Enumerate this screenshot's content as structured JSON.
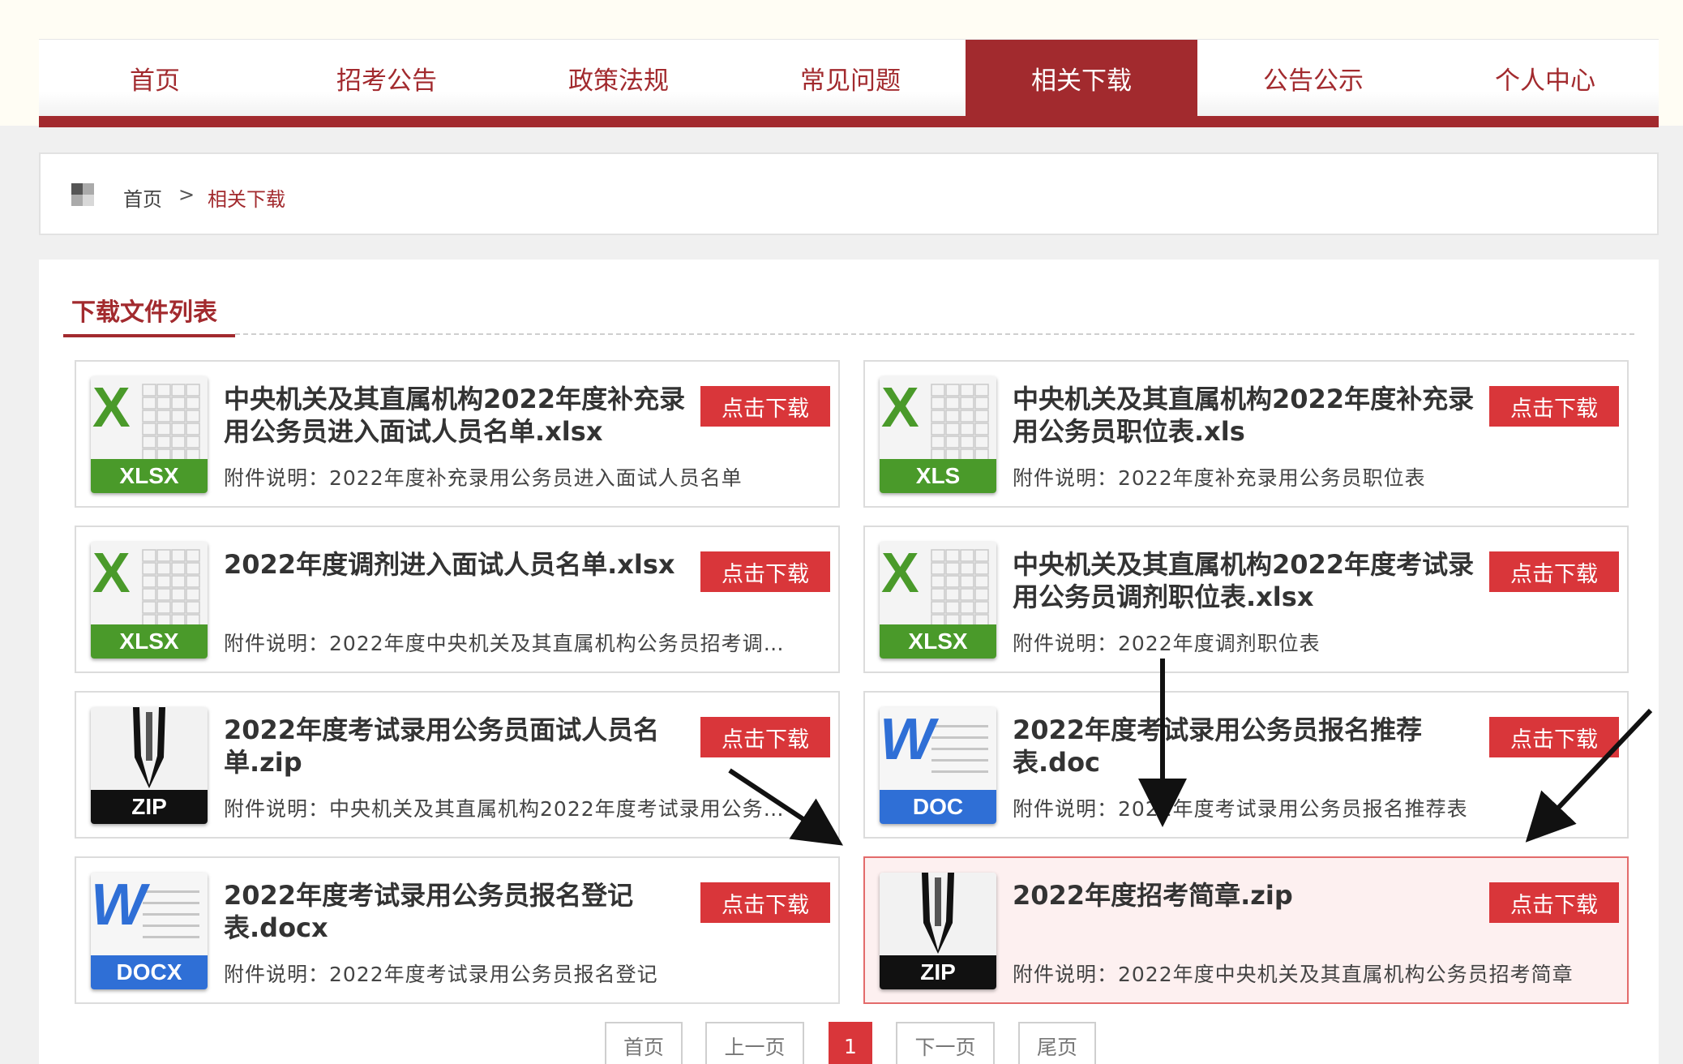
{
  "nav": {
    "items": [
      {
        "label": "首页"
      },
      {
        "label": "招考公告"
      },
      {
        "label": "政策法规"
      },
      {
        "label": "常见问题"
      },
      {
        "label": "相关下载",
        "active": true
      },
      {
        "label": "公告公示"
      },
      {
        "label": "个人中心"
      }
    ]
  },
  "breadcrumb": {
    "home": "首页",
    "separator": ">",
    "current": "相关下载"
  },
  "panel": {
    "title": "下载文件列表"
  },
  "files": [
    {
      "type": "XLSX",
      "title": "中央机关及其直属机构2022年度补充录用公务员进入面试人员名单.xlsx",
      "desc": "附件说明：2022年度补充录用公务员进入面试人员名单",
      "button": "点击下载"
    },
    {
      "type": "XLS",
      "title": "中央机关及其直属机构2022年度补充录用公务员职位表.xls",
      "desc": "附件说明：2022年度补充录用公务员职位表",
      "button": "点击下载"
    },
    {
      "type": "XLSX",
      "title": "2022年度调剂进入面试人员名单.xlsx",
      "desc": "附件说明：2022年度中央机关及其直属机构公务员招考调…",
      "button": "点击下载"
    },
    {
      "type": "XLSX",
      "title": "中央机关及其直属机构2022年度考试录用公务员调剂职位表.xlsx",
      "desc": "附件说明：2022年度调剂职位表",
      "button": "点击下载"
    },
    {
      "type": "ZIP",
      "title": "2022年度考试录用公务员面试人员名单.zip",
      "desc": "附件说明：中央机关及其直属机构2022年度考试录用公务…",
      "button": "点击下载"
    },
    {
      "type": "DOC",
      "title": "2022年度考试录用公务员报名推荐表.doc",
      "desc": "附件说明：2022年度考试录用公务员报名推荐表",
      "button": "点击下载"
    },
    {
      "type": "DOCX",
      "title": "2022年度考试录用公务员报名登记表.docx",
      "desc": "附件说明：2022年度考试录用公务员报名登记",
      "button": "点击下载"
    },
    {
      "type": "ZIP",
      "title": "2022年度招考简章.zip",
      "desc": "附件说明：2022年度中央机关及其直属机构公务员招考简章",
      "button": "点击下载",
      "highlighted": true
    }
  ],
  "pagination": {
    "first": "首页",
    "prev": "上一页",
    "current": "1",
    "next": "下一页",
    "last": "尾页"
  },
  "colors": {
    "brand": "#a22a2e",
    "button": "#d9363a",
    "excel_green": "#4a9a2a",
    "word_blue": "#2f6fd6",
    "zip_black": "#111111"
  }
}
